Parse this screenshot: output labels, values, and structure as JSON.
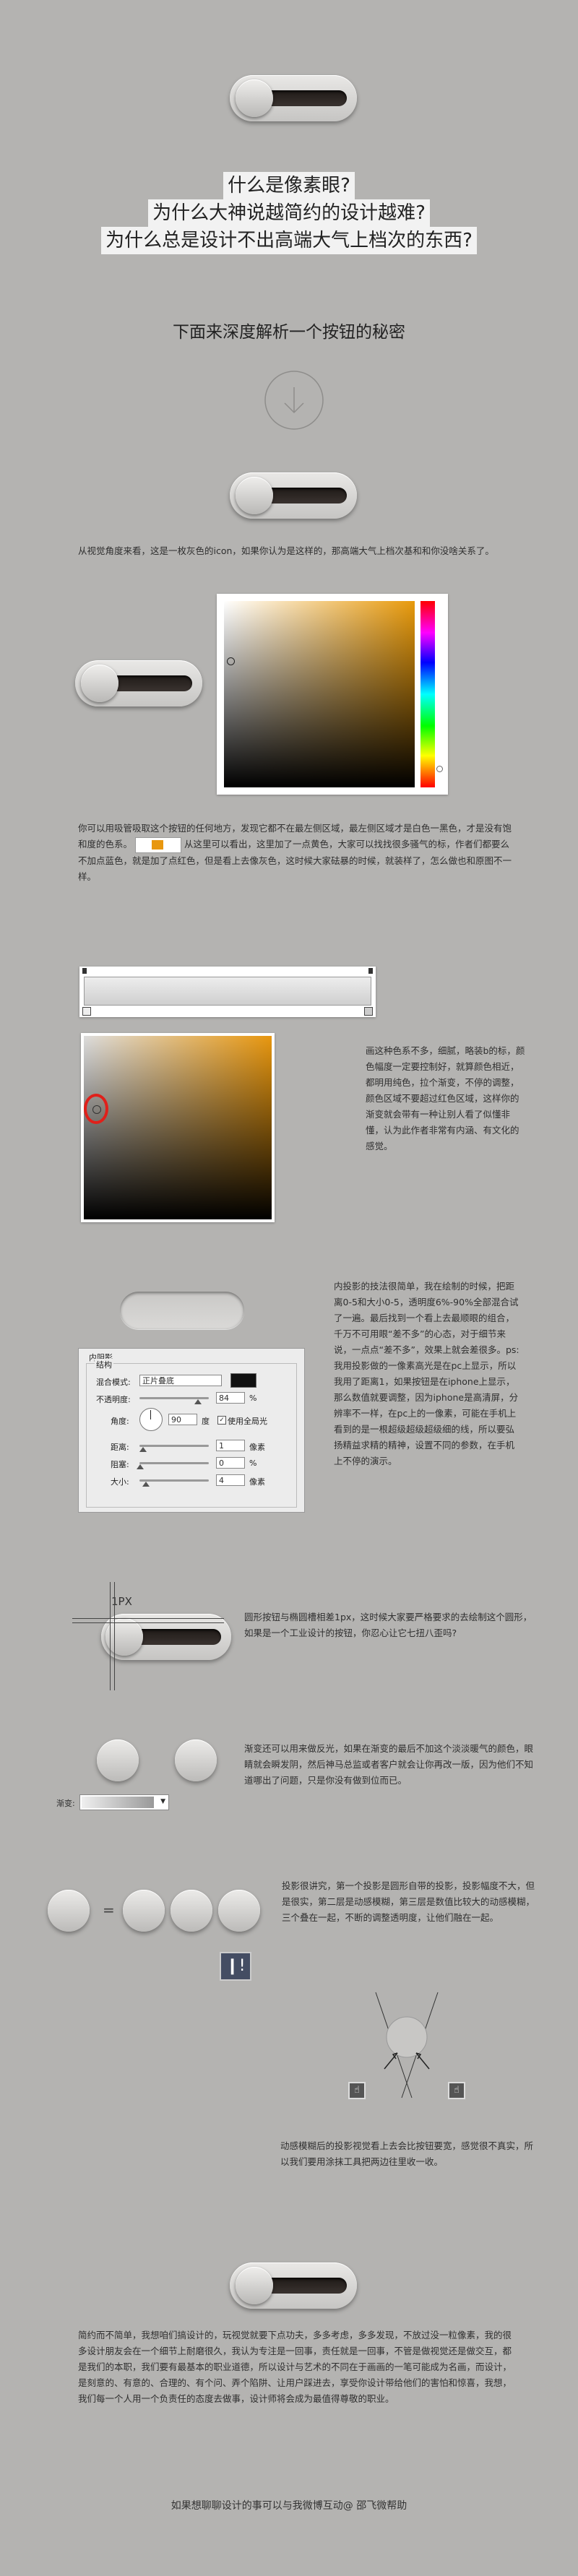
{
  "titles": {
    "line1": "什么是像素眼?",
    "line2": "为什么大神说越简约的设计越难?",
    "line3": "为什么总是设计不出高端大气上档次的东西?"
  },
  "subtitle": "下面来深度解析一个按钮的秘密",
  "paragraphs": {
    "p1": "从视觉角度来看，这是一枚灰色的icon，如果你认为是这样的，那高端大气上档次基和和你没啥关系了。",
    "p2a": "你可以用吸管吸取这个按钮的任何地方，发现它都不在最左侧区域，最左侧区域才是白色一黑色，才是没有饱和度的色系。",
    "p2b": "从这里可以看出，这里加了一点黄色，大家可以找找很多骚气的标，作者们都要么不加点蓝色，就是加了点红色，但是看上去像灰色，这时候大家砝暴的时候，就装样了，怎么做也和原图不一样。",
    "p3": "画这种色系不多，细腻，略装b的标，颜色幅度一定要控制好，就算颜色相近，都明用纯色，拉个渐变，不停的调整，颜色区域不要超过红色区域，这样你的渐变就会带有一种让别人看了似懂非懂，认为此作者非常有内涵、有文化的感觉。",
    "p4": "内投影的技法很简单，我在绘制的时候，把距离0-5和大小0-5，透明度6%-90%全部混合试了一遍。最后找到一个看上去最顺眼的组合，千万不可用眼“差不多”的心态，对于细节来说，一点点“差不多”，效果上就会差很多。ps:我用投影做的一像素高光是在pc上显示，所以我用了距离1，如果按钮是在iphone上显示，那么数值就要调整，因为iphone是高清屏，分辨率不一样，在pc上的一像素，可能在手机上看到的是一根超级超级超级细的线，所以要弘扬精益求精的精神，设置不同的参数，在手机上不停的演示。",
    "p5": "圆形按钮与椭圆槽相差1px，这时候大家要严格要求的去绘制这个圆形，如果是一个工业设计的按钮，你忍心让它七扭八歪吗?",
    "p6": "渐变还可以用来做反光，如果在渐变的最后不加这个淡淡暖气的颜色，眼睛就会瞬发阴，然后神马总监或者客户就会让你再改一版，因为他们不知道哪出了问题，只是你没有做到位而已。",
    "p7": "投影很讲究，第一个投影是圆形自带的投影，投影幅度不大，但是很实，第二层是动感模糊，第三层是数值比较大的动感模糊，三个叠在一起，不断的调整透明度，让他们融在一起。",
    "p8": "动感模糊后的投影视觉看上去会比按钮要宽，感觉很不真实，所以我们要用涂抹工具把两边往里收一收。",
    "p9": "简约而不简单，我想咱们搞设计的，玩视觉就要下点功夫，多多考虑，多多发现，不放过没一粒像素，我的很多设计朋友会在一个细节上耐磨很久，我认为专注是一回事，责任就是一回事，不管是做视觉还是做交互，都是我们的本职，我们要有最基本的职业道德，所以设计与艺术的不同在于画画的一笔可能成为名画，而设计，是刻意的、有意的、合理的、有个问、弄个陷阱、让用户踩进去，享受你设计带给他们的害怕和惊喜，我想，我们每一个人用一个负责任的态度去做事，设计师将会成为最值得尊敬的职业。"
  },
  "footer": "如果想聊聊设计的事可以与我微博互动@ 邵飞微帮助",
  "labels": {
    "one_px": "1PX",
    "gradient_label": "渐变:"
  },
  "dialog": {
    "group_title": "内阴影",
    "struct_title": "结构",
    "blend_mode_label": "混合模式:",
    "blend_mode_value": "正片叠底",
    "opacity_label": "不透明度:",
    "opacity_value": "84",
    "opacity_unit": "%",
    "angle_label": "角度:",
    "angle_value": "90",
    "angle_unit": "度",
    "global_light": "使用全局光",
    "distance_label": "距离:",
    "distance_value": "1",
    "distance_unit": "像素",
    "choke_label": "阻塞:",
    "choke_value": "0",
    "choke_unit": "%",
    "size_label": "大小:",
    "size_value": "4",
    "size_unit": "像素"
  },
  "colors": {
    "background": "#b4b3b1",
    "accent_orange": "#e8970f",
    "highlight_red": "#e0201a",
    "track_dark": "#2a2421"
  },
  "icons": {
    "arrow_circle": "chevron-down-circle-icon",
    "smudge_tool": "smudge-tool-icon"
  }
}
